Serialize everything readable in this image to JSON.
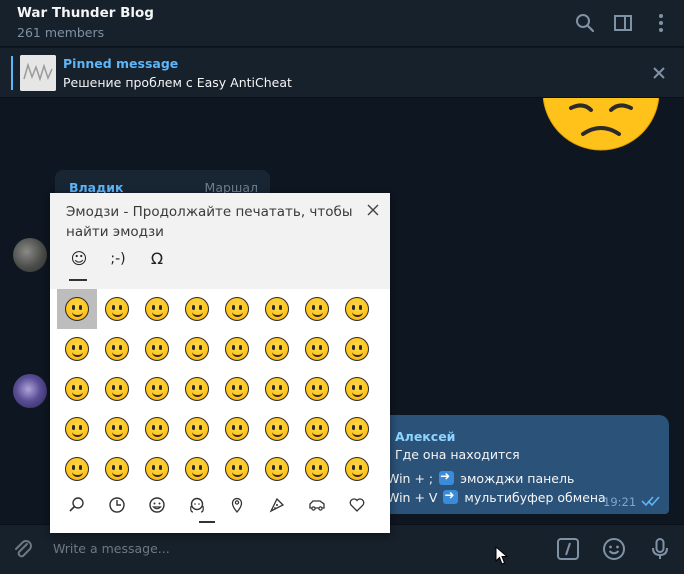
{
  "header": {
    "title": "War Thunder Blog",
    "subtitle": "261 members",
    "icons": [
      "search-icon",
      "sidebar-icon",
      "more-vertical-icon"
    ]
  },
  "pinned": {
    "title": "Pinned message",
    "text": "Решение проблем с Easy AntiCheat"
  },
  "messages": {
    "incoming": {
      "sender": "Владик",
      "tag": "Маршал"
    },
    "outgoing": {
      "sender": "Алексей",
      "line1": "Где она находится",
      "line2_prefix": "Win + ;",
      "line2_suffix": "эможджи панель",
      "line3_prefix": "Win + V",
      "line3_suffix": "мультибуфер обмена",
      "time": "19:21"
    }
  },
  "input": {
    "placeholder": "Write a message...",
    "icons": [
      "attach-icon",
      "commands-icon",
      "emoji-icon",
      "mic-icon"
    ]
  },
  "emoji_panel": {
    "hint": "Эмодзи - Продолжайте печатать, чтобы найти эмодзи",
    "tabs": [
      "☺",
      ";-)",
      "Ω"
    ],
    "selected_tab": 0,
    "selected_emoji_index": 0,
    "emoji_count": 40,
    "categories": [
      "search-icon",
      "recent-icon",
      "smileys-icon",
      "people-icon",
      "places-icon",
      "food-icon",
      "travel-icon",
      "heart-icon"
    ],
    "selected_category": 2
  },
  "colors": {
    "accent": "#5eb5f7",
    "bubble_out": "#2b5278",
    "background": "#0e1621",
    "panel_bg": "#ffffff"
  }
}
